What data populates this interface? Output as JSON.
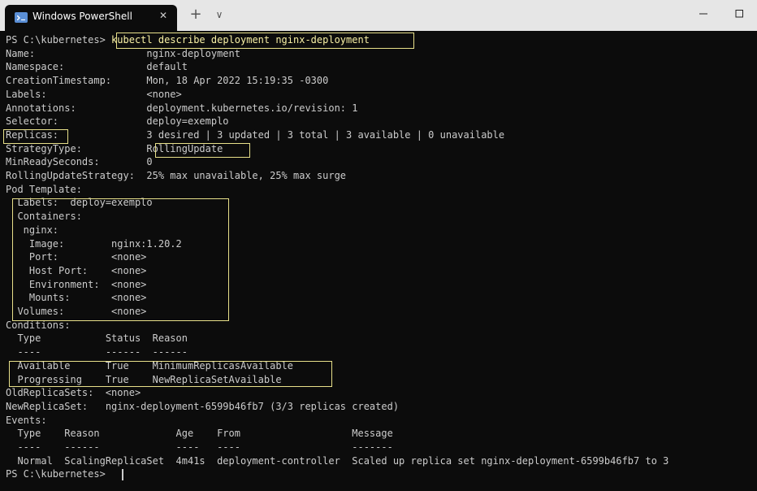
{
  "window": {
    "tab_title": "Windows PowerShell",
    "close_glyph": "✕",
    "new_tab_glyph": "+",
    "dropdown_glyph": "∨"
  },
  "console": {
    "prompt": "PS C:\\kubernetes> ",
    "command": "kubectl describe deployment nginx-deployment",
    "output": [
      "Name:                   nginx-deployment",
      "Namespace:              default",
      "CreationTimestamp:      Mon, 18 Apr 2022 15:19:35 -0300",
      "Labels:                 <none>",
      "Annotations:            deployment.kubernetes.io/revision: 1",
      "Selector:               deploy=exemplo",
      "Replicas:               3 desired | 3 updated | 3 total | 3 available | 0 unavailable",
      "StrategyType:           RollingUpdate",
      "MinReadySeconds:        0",
      "RollingUpdateStrategy:  25% max unavailable, 25% max surge",
      "Pod Template:",
      "  Labels:  deploy=exemplo",
      "  Containers:",
      "   nginx:",
      "    Image:        nginx:1.20.2",
      "    Port:         <none>",
      "    Host Port:    <none>",
      "    Environment:  <none>",
      "    Mounts:       <none>",
      "  Volumes:        <none>",
      "Conditions:",
      "  Type           Status  Reason",
      "  ----           ------  ------",
      "  Available      True    MinimumReplicasAvailable",
      "  Progressing    True    NewReplicaSetAvailable",
      "OldReplicaSets:  <none>",
      "NewReplicaSet:   nginx-deployment-6599b46fb7 (3/3 replicas created)",
      "Events:",
      "  Type    Reason             Age    From                   Message",
      "  ----    ------             ----   ----                   -------",
      "  Normal  ScalingReplicaSet  4m41s  deployment-controller  Scaled up replica set nginx-deployment-6599b46fb7 to 3"
    ],
    "final_prompt": "PS C:\\kubernetes> "
  },
  "colors": {
    "console_bg": "#0c0c0c",
    "console_text": "#cccccc",
    "command_text": "#f9f1a5",
    "highlight_border": "#e8e08a",
    "titlebar_bg": "#e6e6e6"
  }
}
